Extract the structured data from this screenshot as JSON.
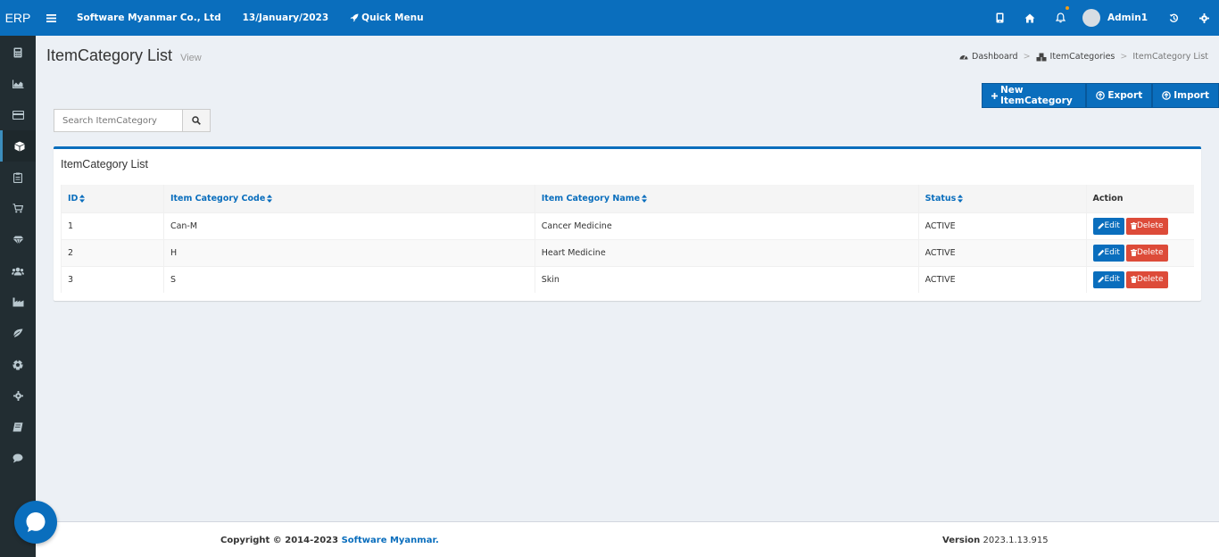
{
  "header": {
    "logo": "ERP",
    "company": "Software Myanmar Co., Ltd",
    "date": "13/January/2023",
    "quick_menu": "Quick Menu",
    "user": "Admin1"
  },
  "sidebar": {
    "items": [
      {
        "icon": "calculator-icon"
      },
      {
        "icon": "area-chart-icon"
      },
      {
        "icon": "credit-card-icon"
      },
      {
        "icon": "cube-icon",
        "active": true
      },
      {
        "icon": "clipboard-icon"
      },
      {
        "icon": "shopping-cart-icon"
      },
      {
        "icon": "diamond-icon"
      },
      {
        "icon": "users-icon"
      },
      {
        "icon": "industry-icon"
      },
      {
        "icon": "leaf-icon"
      },
      {
        "icon": "soccer-ball-icon"
      },
      {
        "icon": "gear-icon"
      },
      {
        "icon": "book-icon"
      },
      {
        "icon": "comment-icon"
      }
    ]
  },
  "page": {
    "title": "ItemCategory List",
    "subtitle": "View"
  },
  "breadcrumb": {
    "dashboard": "Dashboard",
    "item_categories": "ItemCategories",
    "current": "ItemCategory List",
    "separator": ">"
  },
  "actions": {
    "new": "New ItemCategory",
    "export": "Export",
    "import": "Import"
  },
  "search": {
    "placeholder": "Search ItemCategory"
  },
  "table": {
    "box_title": "ItemCategory List",
    "headers": {
      "id": "ID",
      "code": "Item Category Code",
      "name": "Item Category Name",
      "status": "Status",
      "action": "Action"
    },
    "rows": [
      {
        "id": "1",
        "code": "Can-M",
        "name": "Cancer Medicine",
        "status": "ACTIVE"
      },
      {
        "id": "2",
        "code": "H",
        "name": "Heart Medicine",
        "status": "ACTIVE"
      },
      {
        "id": "3",
        "code": "S",
        "name": "Skin",
        "status": "ACTIVE"
      }
    ],
    "edit_label": "Edit",
    "delete_label": "Delete"
  },
  "footer": {
    "copyright": "Copyright © 2014-2023",
    "brand": "Software Myanmar.",
    "version_label": "Version",
    "version": "2023.1.13.915"
  },
  "colors": {
    "primary": "#0a6ebd",
    "sidebar": "#222d32",
    "danger": "#dd4b39",
    "background": "#ecf0f5"
  }
}
